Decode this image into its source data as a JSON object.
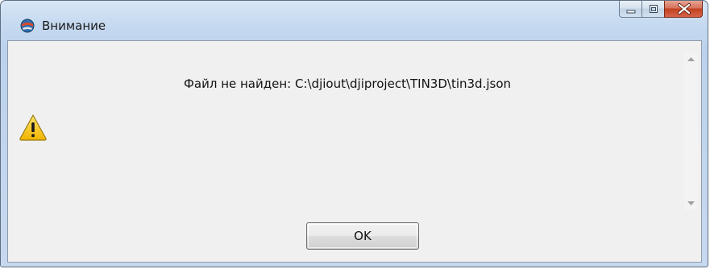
{
  "window": {
    "title": "Внимание",
    "app_icon": "app-globe-icon",
    "caption": {
      "minimize_icon": "minimize-icon",
      "maximize_icon": "maximize-icon",
      "close_icon": "close-icon"
    }
  },
  "dialog": {
    "message": "Файл не найден: C:\\djiout\\djiproject\\TIN3D\\tin3d.json",
    "icon": "warning-icon",
    "ok_label": "OK"
  },
  "colors": {
    "frame": "#c6daf0",
    "close_button": "#c2401f",
    "client_background": "#f0f0f0",
    "warning_yellow": "#f5c400"
  }
}
